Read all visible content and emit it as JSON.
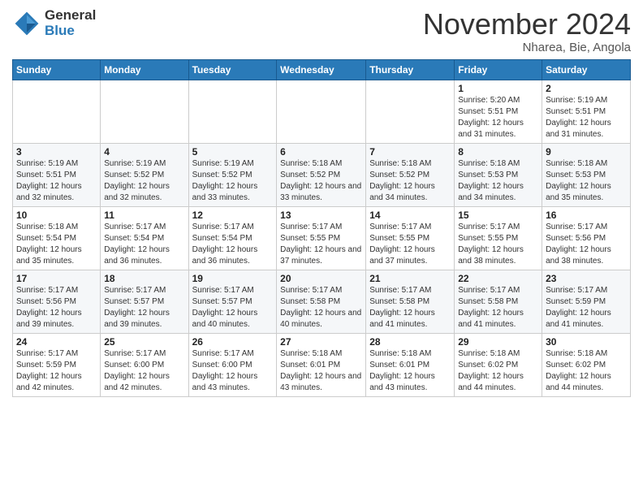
{
  "logo": {
    "general": "General",
    "blue": "Blue"
  },
  "header": {
    "month": "November 2024",
    "location": "Nharea, Bie, Angola"
  },
  "weekdays": [
    "Sunday",
    "Monday",
    "Tuesday",
    "Wednesday",
    "Thursday",
    "Friday",
    "Saturday"
  ],
  "weeks": [
    [
      {
        "day": "",
        "info": ""
      },
      {
        "day": "",
        "info": ""
      },
      {
        "day": "",
        "info": ""
      },
      {
        "day": "",
        "info": ""
      },
      {
        "day": "",
        "info": ""
      },
      {
        "day": "1",
        "info": "Sunrise: 5:20 AM\nSunset: 5:51 PM\nDaylight: 12 hours and 31 minutes."
      },
      {
        "day": "2",
        "info": "Sunrise: 5:19 AM\nSunset: 5:51 PM\nDaylight: 12 hours and 31 minutes."
      }
    ],
    [
      {
        "day": "3",
        "info": "Sunrise: 5:19 AM\nSunset: 5:51 PM\nDaylight: 12 hours and 32 minutes."
      },
      {
        "day": "4",
        "info": "Sunrise: 5:19 AM\nSunset: 5:52 PM\nDaylight: 12 hours and 32 minutes."
      },
      {
        "day": "5",
        "info": "Sunrise: 5:19 AM\nSunset: 5:52 PM\nDaylight: 12 hours and 33 minutes."
      },
      {
        "day": "6",
        "info": "Sunrise: 5:18 AM\nSunset: 5:52 PM\nDaylight: 12 hours and 33 minutes."
      },
      {
        "day": "7",
        "info": "Sunrise: 5:18 AM\nSunset: 5:52 PM\nDaylight: 12 hours and 34 minutes."
      },
      {
        "day": "8",
        "info": "Sunrise: 5:18 AM\nSunset: 5:53 PM\nDaylight: 12 hours and 34 minutes."
      },
      {
        "day": "9",
        "info": "Sunrise: 5:18 AM\nSunset: 5:53 PM\nDaylight: 12 hours and 35 minutes."
      }
    ],
    [
      {
        "day": "10",
        "info": "Sunrise: 5:18 AM\nSunset: 5:54 PM\nDaylight: 12 hours and 35 minutes."
      },
      {
        "day": "11",
        "info": "Sunrise: 5:17 AM\nSunset: 5:54 PM\nDaylight: 12 hours and 36 minutes."
      },
      {
        "day": "12",
        "info": "Sunrise: 5:17 AM\nSunset: 5:54 PM\nDaylight: 12 hours and 36 minutes."
      },
      {
        "day": "13",
        "info": "Sunrise: 5:17 AM\nSunset: 5:55 PM\nDaylight: 12 hours and 37 minutes."
      },
      {
        "day": "14",
        "info": "Sunrise: 5:17 AM\nSunset: 5:55 PM\nDaylight: 12 hours and 37 minutes."
      },
      {
        "day": "15",
        "info": "Sunrise: 5:17 AM\nSunset: 5:55 PM\nDaylight: 12 hours and 38 minutes."
      },
      {
        "day": "16",
        "info": "Sunrise: 5:17 AM\nSunset: 5:56 PM\nDaylight: 12 hours and 38 minutes."
      }
    ],
    [
      {
        "day": "17",
        "info": "Sunrise: 5:17 AM\nSunset: 5:56 PM\nDaylight: 12 hours and 39 minutes."
      },
      {
        "day": "18",
        "info": "Sunrise: 5:17 AM\nSunset: 5:57 PM\nDaylight: 12 hours and 39 minutes."
      },
      {
        "day": "19",
        "info": "Sunrise: 5:17 AM\nSunset: 5:57 PM\nDaylight: 12 hours and 40 minutes."
      },
      {
        "day": "20",
        "info": "Sunrise: 5:17 AM\nSunset: 5:58 PM\nDaylight: 12 hours and 40 minutes."
      },
      {
        "day": "21",
        "info": "Sunrise: 5:17 AM\nSunset: 5:58 PM\nDaylight: 12 hours and 41 minutes."
      },
      {
        "day": "22",
        "info": "Sunrise: 5:17 AM\nSunset: 5:58 PM\nDaylight: 12 hours and 41 minutes."
      },
      {
        "day": "23",
        "info": "Sunrise: 5:17 AM\nSunset: 5:59 PM\nDaylight: 12 hours and 41 minutes."
      }
    ],
    [
      {
        "day": "24",
        "info": "Sunrise: 5:17 AM\nSunset: 5:59 PM\nDaylight: 12 hours and 42 minutes."
      },
      {
        "day": "25",
        "info": "Sunrise: 5:17 AM\nSunset: 6:00 PM\nDaylight: 12 hours and 42 minutes."
      },
      {
        "day": "26",
        "info": "Sunrise: 5:17 AM\nSunset: 6:00 PM\nDaylight: 12 hours and 43 minutes."
      },
      {
        "day": "27",
        "info": "Sunrise: 5:18 AM\nSunset: 6:01 PM\nDaylight: 12 hours and 43 minutes."
      },
      {
        "day": "28",
        "info": "Sunrise: 5:18 AM\nSunset: 6:01 PM\nDaylight: 12 hours and 43 minutes."
      },
      {
        "day": "29",
        "info": "Sunrise: 5:18 AM\nSunset: 6:02 PM\nDaylight: 12 hours and 44 minutes."
      },
      {
        "day": "30",
        "info": "Sunrise: 5:18 AM\nSunset: 6:02 PM\nDaylight: 12 hours and 44 minutes."
      }
    ]
  ]
}
